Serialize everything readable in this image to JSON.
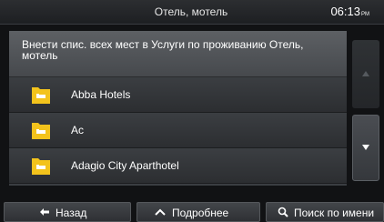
{
  "header": {
    "title": "Отель, мотель",
    "time": "06:13",
    "time_suffix": "PM"
  },
  "info": {
    "text": "Внести спис. всех мест в Услуги по проживанию Отель, мотель"
  },
  "list": {
    "items": [
      {
        "label": "Abba Hotels",
        "icon": "hotel-bed-icon"
      },
      {
        "label": "Ac",
        "icon": "hotel-bed-icon"
      },
      {
        "label": "Adagio City Aparthotel",
        "icon": "hotel-bed-icon"
      }
    ]
  },
  "footer": {
    "back_label": "Назад",
    "more_label": "Подробнее",
    "search_label": "Поиск по имени"
  },
  "colors": {
    "icon_yellow": "#f3c31c",
    "indicator_green": "#5fd24a"
  }
}
